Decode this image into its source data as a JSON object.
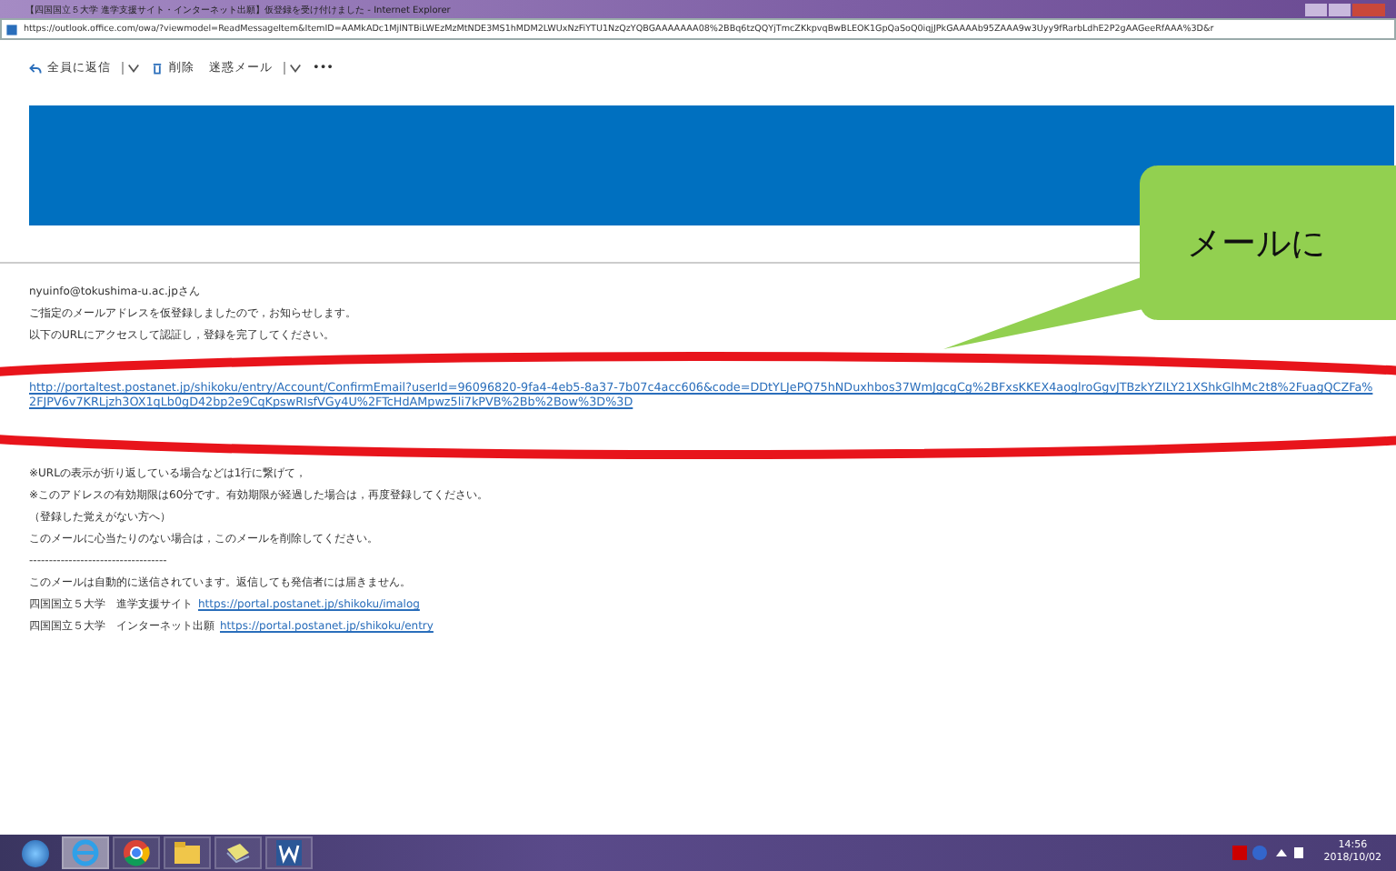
{
  "window": {
    "title": "【四国国立５大学 進学支援サイト・インターネット出願】仮登録を受け付けました - Internet Explorer"
  },
  "address_bar": {
    "url": "https://outlook.office.com/owa/?viewmodel=ReadMessageItem&ItemID=AAMkADc1MjlNTBiLWEzMzMtNDE3MS1hMDM2LWUxNzFiYTU1NzQzYQBGAAAAAAA08%2BBq6tzQQYjTmcZKkpvqBwBLEOK1GpQaSoQ0iqjJPkGAAAAb95ZAAA9w3Uyy9fRarbLdhE2P2gAAGeeRfAAA%3D&r"
  },
  "toolbar": {
    "items": [
      {
        "label": "全員に返信",
        "kind": "reply"
      },
      {
        "label": "削除",
        "kind": "delete"
      },
      {
        "label": "迷惑メール",
        "kind": "junk"
      },
      {
        "label": "•••",
        "kind": "more"
      }
    ]
  },
  "callout": {
    "text": "メールに"
  },
  "email": {
    "lines": [
      {
        "kind": "text",
        "text": "nyuinfo@tokushima-u.ac.jpさん"
      },
      {
        "kind": "text",
        "text": "ご指定のメールアドレスを仮登録しましたので，お知らせします。"
      },
      {
        "kind": "text",
        "text": "以下のURLにアクセスして認証し，登録を完了してください。"
      },
      {
        "kind": "link",
        "text": "http://portaltest.postanet.jp/shikoku/entry/Account/ConfirmEmail?userId=96096820-9fa4-4eb5-8a37-7b07c4acc606&code=DDtYLJePQ75hNDuxhbos37WmJgcgCg%2BFxsKKEX4aoglroGgvJTBzkYZILY21XShkGlhMc2t8%2FuagQCZFa%2FJPV6v7KRLjzh3OX1qLb0gD42bp2e9CqKpswRIsfVGy4U%2FTcHdAMpwz5li7kPVB%2Bb%2Bow%3D%3D"
      },
      {
        "kind": "text",
        "text": "※URLの表示が折り返している場合などは1行に繋げて，"
      },
      {
        "kind": "text",
        "text": "※このアドレスの有効期限は60分です。有効期限が経過した場合は，再度登録してください。"
      },
      {
        "kind": "text",
        "text": "（登録した覚えがない方へ）"
      },
      {
        "kind": "text",
        "text": "このメールに心当たりのない場合は，このメールを削除してください。"
      },
      {
        "kind": "text",
        "text": "-----------------------------------"
      },
      {
        "kind": "text",
        "text": "このメールは自動的に送信されています。返信しても発信者には届きません。"
      },
      {
        "kind": "signature",
        "text": "四国国立５大学　進学支援サイト",
        "link": "https://portal.postanet.jp/shikoku/imalog"
      },
      {
        "kind": "signature",
        "text": "四国国立５大学　インターネット出願",
        "link": "https://portal.postanet.jp/shikoku/entry"
      }
    ]
  },
  "taskbar": {
    "apps": [
      {
        "kind": "ie",
        "selected": true
      },
      {
        "kind": "chrome",
        "selected": false
      },
      {
        "kind": "folder",
        "selected": false
      },
      {
        "kind": "notes",
        "selected": false
      },
      {
        "kind": "word",
        "selected": false
      }
    ],
    "time": "14:56",
    "date": "2018/10/02"
  }
}
